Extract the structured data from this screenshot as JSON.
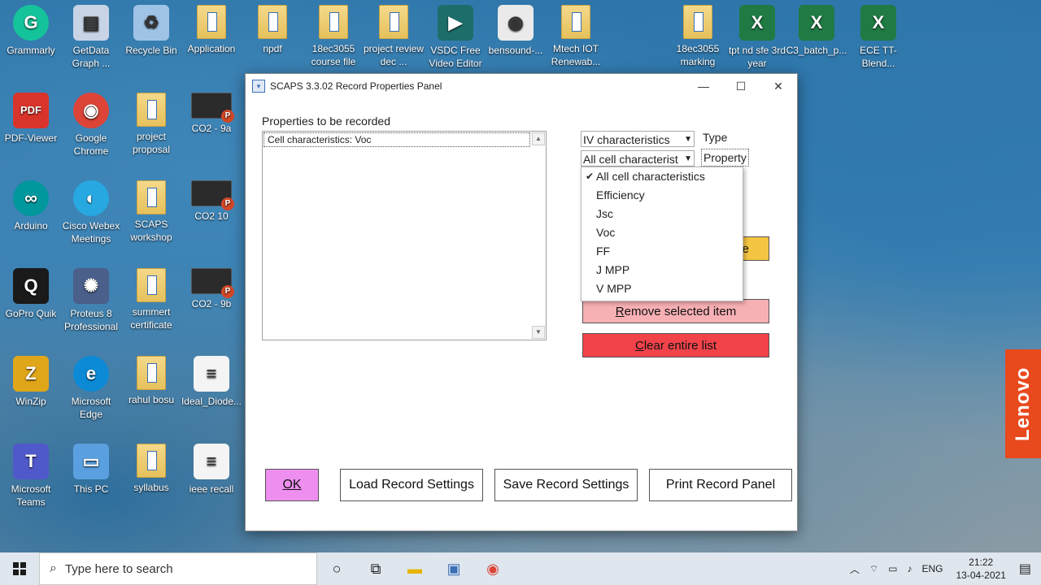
{
  "desktop": {
    "icons": [
      {
        "label": "Grammarly",
        "icon": "grammarly-icon"
      },
      {
        "label": "GetData Graph ...",
        "icon": "getdata-icon"
      },
      {
        "label": "Recycle Bin",
        "icon": "recycle-bin-icon"
      },
      {
        "label": "Application",
        "icon": "folder-icon"
      },
      {
        "label": "npdf",
        "icon": "folder-icon"
      },
      {
        "label": "18ec3055 course file",
        "icon": "folder-icon"
      },
      {
        "label": "project review dec ...",
        "icon": "folder-icon"
      },
      {
        "label": "VSDC Free Video Editor",
        "icon": "vsdc-icon"
      },
      {
        "label": "bensound-...",
        "icon": "audio-file-icon"
      },
      {
        "label": "Mtech IOT Renewab...",
        "icon": "folder-icon"
      },
      {
        "label": "18ec3055 marking",
        "icon": "folder-icon"
      },
      {
        "label": "tpt nd sfe 3rd year",
        "icon": "excel-icon"
      },
      {
        "label": "C3_batch_p...",
        "icon": "excel-icon"
      },
      {
        "label": "ECE TT-Blend...",
        "icon": "excel-icon"
      },
      {
        "label": "PDF-Viewer",
        "icon": "pdf-viewer-icon"
      },
      {
        "label": "Google Chrome",
        "icon": "chrome-icon"
      },
      {
        "label": "project proposal",
        "icon": "folder-icon"
      },
      {
        "label": "CO2 - 9a",
        "icon": "ppt-file-icon"
      },
      {
        "label": "Arduino",
        "icon": "arduino-icon"
      },
      {
        "label": "Cisco Webex Meetings",
        "icon": "webex-icon"
      },
      {
        "label": "SCAPS workshop",
        "icon": "folder-icon"
      },
      {
        "label": "CO2 10",
        "icon": "ppt-file-icon"
      },
      {
        "label": "GoPro Quik",
        "icon": "gopro-icon"
      },
      {
        "label": "Proteus 8 Professional",
        "icon": "proteus-icon"
      },
      {
        "label": "summert certificate",
        "icon": "folder-icon"
      },
      {
        "label": "CO2 - 9b",
        "icon": "ppt-file-icon"
      },
      {
        "label": "WinZip",
        "icon": "winzip-icon"
      },
      {
        "label": "Microsoft Edge",
        "icon": "edge-icon"
      },
      {
        "label": "rahul bosu",
        "icon": "folder-icon"
      },
      {
        "label": "Ideal_Diode...",
        "icon": "document-icon"
      },
      {
        "label": "Microsoft Teams",
        "icon": "teams-icon"
      },
      {
        "label": "This PC",
        "icon": "this-pc-icon"
      },
      {
        "label": "syllabus",
        "icon": "folder-icon"
      },
      {
        "label": "ieee recall",
        "icon": "document-icon"
      }
    ]
  },
  "window": {
    "title": "SCAPS 3.3.02 Record Properties Panel",
    "properties_label": "Properties to be recorded",
    "recorded_items": [
      "Cell characteristics: Voc"
    ],
    "type_select": "IV characteristics",
    "type_label": "Type",
    "property_select": "All cell characterist",
    "property_label": "Property",
    "dropdown_options": [
      {
        "label": "All cell characteristics",
        "checked": true
      },
      {
        "label": "Efficiency",
        "checked": false
      },
      {
        "label": "Jsc",
        "checked": false
      },
      {
        "label": "Voc",
        "checked": false
      },
      {
        "label": "FF",
        "checked": false
      },
      {
        "label": "J MPP",
        "checked": false
      },
      {
        "label": "V MPP",
        "checked": false
      }
    ],
    "add_button_visible_text": "e",
    "remove_button": {
      "first": "R",
      "rest": "emove selected item"
    },
    "clear_button": {
      "first": "C",
      "rest": "lear entire list"
    },
    "ok_button": "OK",
    "load_button": "Load Record Settings",
    "save_button": "Save Record Settings",
    "print_button": "Print Record Panel"
  },
  "taskbar": {
    "search_placeholder": "Type here to search",
    "language": "ENG",
    "time": "21:22",
    "date": "13-04-2021"
  },
  "brand": {
    "text": "Lenovo",
    "color": "#e8491d"
  }
}
